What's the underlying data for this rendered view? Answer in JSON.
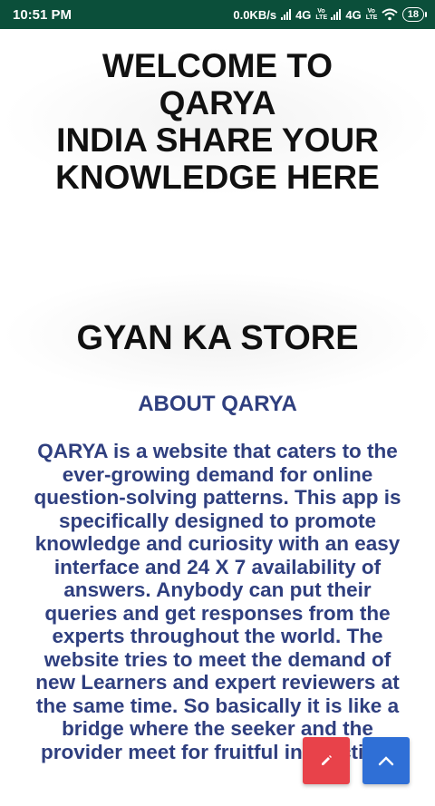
{
  "status_bar": {
    "time": "10:51 PM",
    "net_speed": "0.0KB/s",
    "sim1_type": "4G",
    "sim1_tag": "Vo LTE",
    "sim2_type": "4G",
    "sim2_tag": "Vo LTE",
    "battery": "18"
  },
  "hero": {
    "line1": "WELCOME TO",
    "line2": "QARYA",
    "line3": "INDIA SHARE YOUR",
    "line4": "KNOWLEDGE HERE"
  },
  "store": {
    "title": "GYAN KA STORE"
  },
  "about": {
    "heading": "ABOUT QARYA",
    "body": "QARYA is a website that caters to the ever-growing demand for online question-solving patterns. This app is specifically designed to promote knowledge and curiosity with an easy interface and 24 X 7 availability of answers. Anybody can put their queries and get responses from the experts throughout the world. The website tries to meet the demand of new Learners and expert reviewers at the same time. So basically it is like a bridge where the seeker and the provider meet for fruitful interaction."
  },
  "fabs": {
    "edit_icon": "pencil-icon",
    "up_icon": "chevron-up-icon",
    "edit_color": "#e8424a",
    "up_color": "#2f6fd6"
  },
  "colors": {
    "status_bar": "#0b4f3a",
    "text_dark": "#111111",
    "text_accent": "#2f3f7f"
  }
}
